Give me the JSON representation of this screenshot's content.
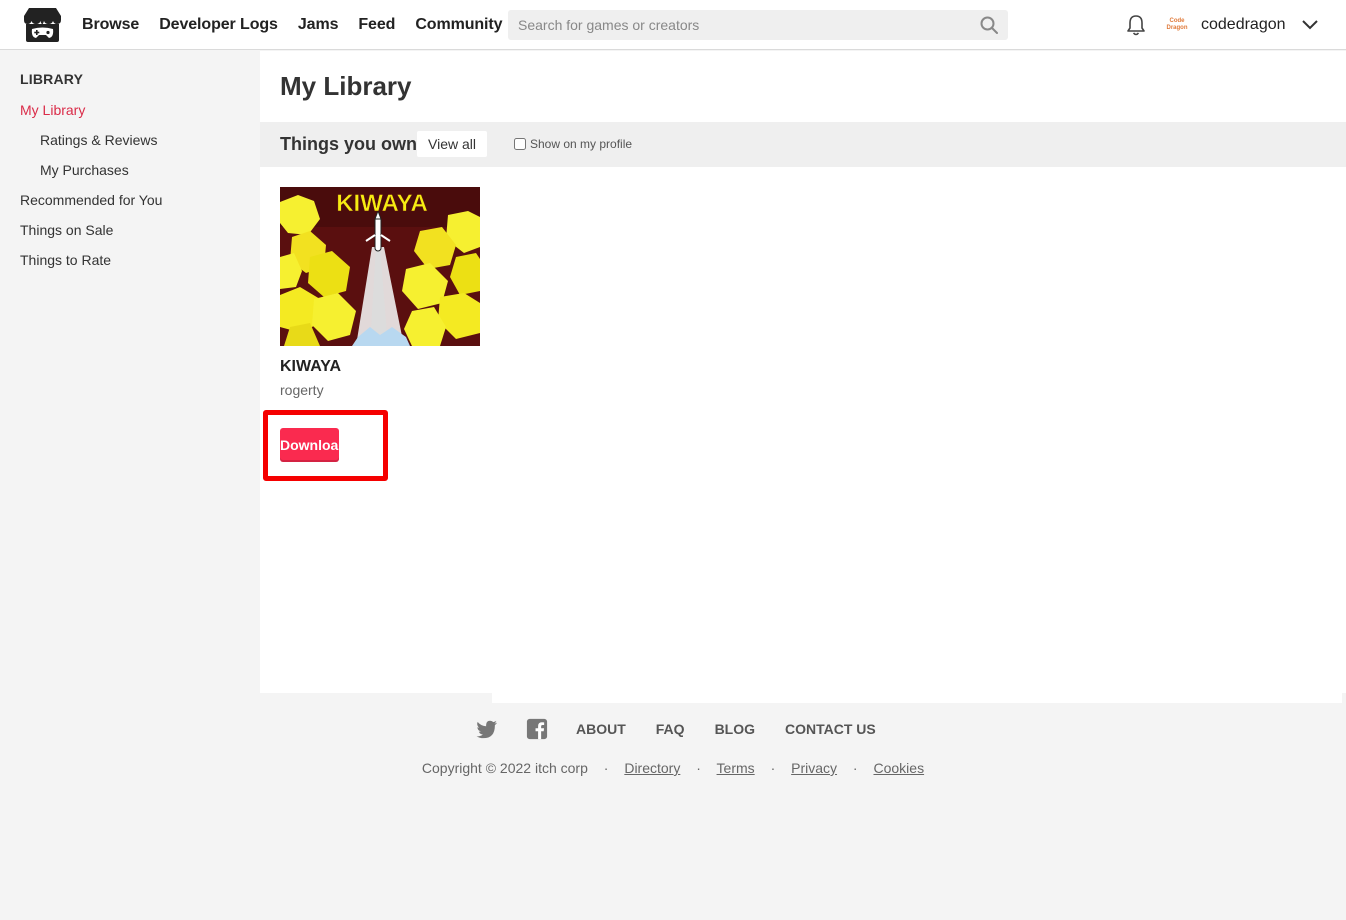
{
  "header": {
    "logo_icon": "itchio-logo-icon",
    "nav": [
      "Browse",
      "Developer Logs",
      "Jams",
      "Feed",
      "Community"
    ],
    "search_placeholder": "Search for games or creators",
    "search_icon": "search-icon",
    "notification_icon": "bell-icon",
    "avatar_text": "Code Dragon",
    "username": "codedragon",
    "menu_icon": "chevron-down-icon"
  },
  "sidebar": {
    "heading": "LIBRARY",
    "items": [
      {
        "label": "My Library",
        "active": true
      },
      {
        "label": "Ratings & Reviews"
      },
      {
        "label": "My Purchases"
      },
      {
        "label": "Recommended for You"
      },
      {
        "label": "Things on Sale"
      },
      {
        "label": "Things to Rate"
      }
    ]
  },
  "main": {
    "title": "My Library",
    "section_title": "Things you own",
    "view_all": "View all",
    "show_profile_label": "Show on my profile",
    "game": {
      "thumb_text": "KIWAYA",
      "title": "KIWAYA",
      "author": "rogerty",
      "download_label": "Download"
    }
  },
  "footer": {
    "social_icons": [
      "twitter-icon",
      "facebook-icon"
    ],
    "links": [
      "ABOUT",
      "FAQ",
      "BLOG",
      "CONTACT US"
    ],
    "copyright": "Copyright © 2022 itch corp",
    "legal": [
      "Directory",
      "Terms",
      "Privacy",
      "Cookies"
    ]
  },
  "colors": {
    "accent": "#da2c49",
    "download_button": "#fa2a4f",
    "highlight_box": "#f50000"
  }
}
